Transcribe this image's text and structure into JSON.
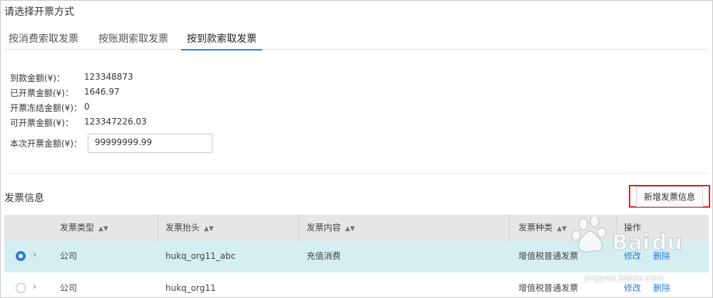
{
  "header": {
    "title": "请选择开票方式"
  },
  "tabs": [
    {
      "label": "按消费索取发票"
    },
    {
      "label": "按账期索取发票"
    },
    {
      "label": "按到款索取发票"
    }
  ],
  "amounts": {
    "received_label": "到款金额(¥)：",
    "received_value": "123348873",
    "invoiced_label": "已开票金额(¥)：",
    "invoiced_value": "1646.97",
    "frozen_label": "开票冻结金额(¥)：",
    "frozen_value": "0",
    "available_label": "可开票金额(¥)：",
    "available_value": "123347226.03",
    "current_label": "本次开票金额(¥)：",
    "current_value": "99999999.99"
  },
  "invoice_section": {
    "title": "发票信息",
    "add_button_label": "新增发票信息"
  },
  "table": {
    "columns": [
      "发票类型",
      "发票抬头",
      "发票内容",
      "发票种类",
      "操作"
    ],
    "rows": [
      {
        "selected": true,
        "type": "公司",
        "header": "hukq_org11_abc",
        "content": "充值消费",
        "kind": "增值税普通发票",
        "edit": "修改",
        "delete": "删除"
      },
      {
        "selected": false,
        "type": "公司",
        "header": "hukq_org11",
        "content": "",
        "kind": "增值税普通发票",
        "edit": "修改",
        "delete": "删除"
      }
    ]
  },
  "watermark": {
    "text": "jingyan.baidu.com"
  },
  "colors": {
    "accent": "#2a7cd6",
    "selected_row": "#d4eef1",
    "highlight_border": "#e02020",
    "header_bg": "#e6e6e6"
  }
}
